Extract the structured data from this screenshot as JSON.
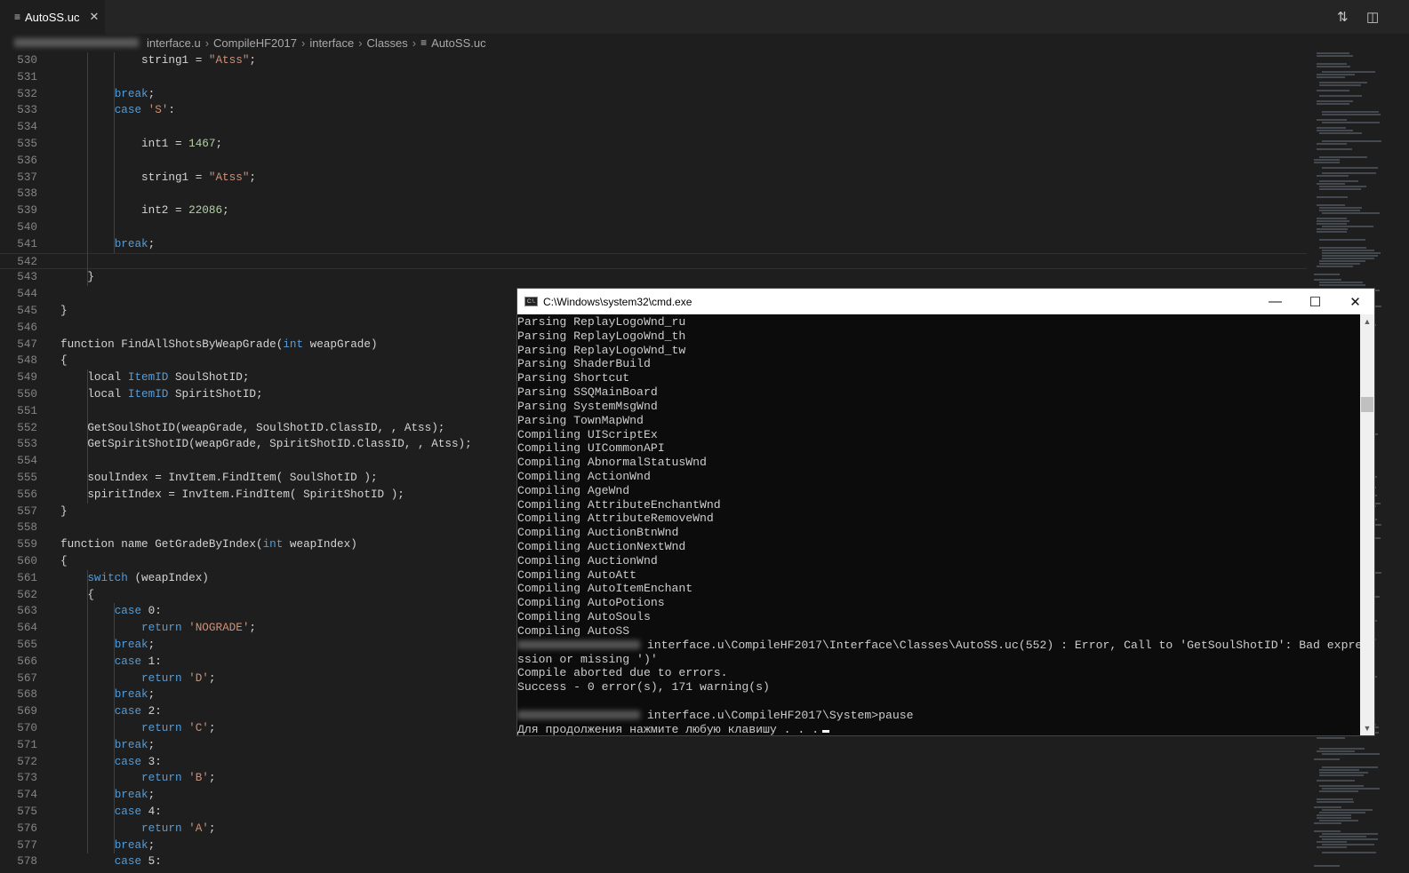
{
  "tab": {
    "icon": "file-lines-icon",
    "label": "AutoSS.uc",
    "close": "✕"
  },
  "toolbar_icons": [
    "compare-changes-icon",
    "split-editor-icon"
  ],
  "breadcrumb": [
    "interface.u",
    "CompileHF2017",
    "interface",
    "Classes",
    "AutoSS.uc"
  ],
  "colors": {
    "keyword": "#569cd6",
    "string": "#ce9178",
    "number": "#b5cea8",
    "text": "#d4d4d4",
    "background": "#1e1e1e"
  },
  "editor": {
    "current_line": 542,
    "lines": [
      {
        "n": 530,
        "tokens": [
          [
            "            string1 = ",
            "p"
          ],
          [
            "\"Atss\"",
            "s"
          ],
          [
            ";",
            "p"
          ]
        ]
      },
      {
        "n": 531,
        "tokens": []
      },
      {
        "n": 532,
        "tokens": [
          [
            "        ",
            "p"
          ],
          [
            "break",
            "k"
          ],
          [
            ";",
            "p"
          ]
        ]
      },
      {
        "n": 533,
        "tokens": [
          [
            "        ",
            "p"
          ],
          [
            "case",
            "k"
          ],
          [
            " ",
            "p"
          ],
          [
            "'S'",
            "s"
          ],
          [
            ":",
            "p"
          ]
        ]
      },
      {
        "n": 534,
        "tokens": []
      },
      {
        "n": 535,
        "tokens": [
          [
            "            int1 = ",
            "p"
          ],
          [
            "1467",
            "n"
          ],
          [
            ";",
            "p"
          ]
        ]
      },
      {
        "n": 536,
        "tokens": []
      },
      {
        "n": 537,
        "tokens": [
          [
            "            string1 = ",
            "p"
          ],
          [
            "\"Atss\"",
            "s"
          ],
          [
            ";",
            "p"
          ]
        ]
      },
      {
        "n": 538,
        "tokens": []
      },
      {
        "n": 539,
        "tokens": [
          [
            "            int2 = ",
            "p"
          ],
          [
            "22086",
            "n"
          ],
          [
            ";",
            "p"
          ]
        ]
      },
      {
        "n": 540,
        "tokens": []
      },
      {
        "n": 541,
        "tokens": [
          [
            "        ",
            "p"
          ],
          [
            "break",
            "k"
          ],
          [
            ";",
            "p"
          ]
        ]
      },
      {
        "n": 542,
        "tokens": []
      },
      {
        "n": 543,
        "tokens": [
          [
            "    }",
            "p"
          ]
        ]
      },
      {
        "n": 544,
        "tokens": []
      },
      {
        "n": 545,
        "tokens": [
          [
            "}",
            "p"
          ]
        ]
      },
      {
        "n": 546,
        "tokens": []
      },
      {
        "n": 547,
        "tokens": [
          [
            "function FindAllShotsByWeapGrade(",
            "p"
          ],
          [
            "int",
            "t"
          ],
          [
            " weapGrade)",
            "p"
          ]
        ]
      },
      {
        "n": 548,
        "tokens": [
          [
            "{",
            "p"
          ]
        ]
      },
      {
        "n": 549,
        "tokens": [
          [
            "    local ",
            "p"
          ],
          [
            "ItemID",
            "t"
          ],
          [
            " SoulShotID;",
            "p"
          ]
        ]
      },
      {
        "n": 550,
        "tokens": [
          [
            "    local ",
            "p"
          ],
          [
            "ItemID",
            "t"
          ],
          [
            " SpiritShotID;",
            "p"
          ]
        ]
      },
      {
        "n": 551,
        "tokens": []
      },
      {
        "n": 552,
        "tokens": [
          [
            "    GetSoulShotID(weapGrade, SoulShotID.ClassID, , Atss);",
            "p"
          ]
        ]
      },
      {
        "n": 553,
        "tokens": [
          [
            "    GetSpiritShotID(weapGrade, SpiritShotID.ClassID, , Atss);",
            "p"
          ]
        ]
      },
      {
        "n": 554,
        "tokens": []
      },
      {
        "n": 555,
        "tokens": [
          [
            "    soulIndex = InvItem.FindItem( SoulShotID );",
            "p"
          ]
        ]
      },
      {
        "n": 556,
        "tokens": [
          [
            "    spiritIndex = InvItem.FindItem( SpiritShotID );",
            "p"
          ]
        ]
      },
      {
        "n": 557,
        "tokens": [
          [
            "}",
            "p"
          ]
        ]
      },
      {
        "n": 558,
        "tokens": []
      },
      {
        "n": 559,
        "tokens": [
          [
            "function name GetGradeByIndex(",
            "p"
          ],
          [
            "int",
            "t"
          ],
          [
            " weapIndex)",
            "p"
          ]
        ]
      },
      {
        "n": 560,
        "tokens": [
          [
            "{",
            "p"
          ]
        ]
      },
      {
        "n": 561,
        "tokens": [
          [
            "    ",
            "p"
          ],
          [
            "switch",
            "k"
          ],
          [
            " (weapIndex)",
            "p"
          ]
        ]
      },
      {
        "n": 562,
        "tokens": [
          [
            "    {",
            "p"
          ]
        ]
      },
      {
        "n": 563,
        "tokens": [
          [
            "        ",
            "p"
          ],
          [
            "case",
            "k"
          ],
          [
            " 0:",
            "p"
          ]
        ]
      },
      {
        "n": 564,
        "tokens": [
          [
            "            ",
            "p"
          ],
          [
            "return",
            "k"
          ],
          [
            " ",
            "p"
          ],
          [
            "'NOGRADE'",
            "s"
          ],
          [
            ";",
            "p"
          ]
        ]
      },
      {
        "n": 565,
        "tokens": [
          [
            "        ",
            "p"
          ],
          [
            "break",
            "k"
          ],
          [
            ";",
            "p"
          ]
        ]
      },
      {
        "n": 566,
        "tokens": [
          [
            "        ",
            "p"
          ],
          [
            "case",
            "k"
          ],
          [
            " 1:",
            "p"
          ]
        ]
      },
      {
        "n": 567,
        "tokens": [
          [
            "            ",
            "p"
          ],
          [
            "return",
            "k"
          ],
          [
            " ",
            "p"
          ],
          [
            "'D'",
            "s"
          ],
          [
            ";",
            "p"
          ]
        ]
      },
      {
        "n": 568,
        "tokens": [
          [
            "        ",
            "p"
          ],
          [
            "break",
            "k"
          ],
          [
            ";",
            "p"
          ]
        ]
      },
      {
        "n": 569,
        "tokens": [
          [
            "        ",
            "p"
          ],
          [
            "case",
            "k"
          ],
          [
            " 2:",
            "p"
          ]
        ]
      },
      {
        "n": 570,
        "tokens": [
          [
            "            ",
            "p"
          ],
          [
            "return",
            "k"
          ],
          [
            " ",
            "p"
          ],
          [
            "'C'",
            "s"
          ],
          [
            ";",
            "p"
          ]
        ]
      },
      {
        "n": 571,
        "tokens": [
          [
            "        ",
            "p"
          ],
          [
            "break",
            "k"
          ],
          [
            ";",
            "p"
          ]
        ]
      },
      {
        "n": 572,
        "tokens": [
          [
            "        ",
            "p"
          ],
          [
            "case",
            "k"
          ],
          [
            " 3:",
            "p"
          ]
        ]
      },
      {
        "n": 573,
        "tokens": [
          [
            "            ",
            "p"
          ],
          [
            "return",
            "k"
          ],
          [
            " ",
            "p"
          ],
          [
            "'B'",
            "s"
          ],
          [
            ";",
            "p"
          ]
        ]
      },
      {
        "n": 574,
        "tokens": [
          [
            "        ",
            "p"
          ],
          [
            "break",
            "k"
          ],
          [
            ";",
            "p"
          ]
        ]
      },
      {
        "n": 575,
        "tokens": [
          [
            "        ",
            "p"
          ],
          [
            "case",
            "k"
          ],
          [
            " 4:",
            "p"
          ]
        ]
      },
      {
        "n": 576,
        "tokens": [
          [
            "            ",
            "p"
          ],
          [
            "return",
            "k"
          ],
          [
            " ",
            "p"
          ],
          [
            "'A'",
            "s"
          ],
          [
            ";",
            "p"
          ]
        ]
      },
      {
        "n": 577,
        "tokens": [
          [
            "        ",
            "p"
          ],
          [
            "break",
            "k"
          ],
          [
            ";",
            "p"
          ]
        ]
      },
      {
        "n": 578,
        "tokens": [
          [
            "        ",
            "p"
          ],
          [
            "case",
            "k"
          ],
          [
            " 5:",
            "p"
          ]
        ]
      }
    ]
  },
  "cmd": {
    "title": "C:\\Windows\\system32\\cmd.exe",
    "icon_label": "C:\\.",
    "buttons": {
      "minimize": "—",
      "maximize": "☐",
      "close": "✕"
    },
    "scroll_up": "▲",
    "scroll_down": "▼",
    "lines": [
      {
        "text": "Parsing ReplayLogoWnd_ru"
      },
      {
        "text": "Parsing ReplayLogoWnd_th"
      },
      {
        "text": "Parsing ReplayLogoWnd_tw"
      },
      {
        "text": "Parsing ShaderBuild"
      },
      {
        "text": "Parsing Shortcut"
      },
      {
        "text": "Parsing SSQMainBoard"
      },
      {
        "text": "Parsing SystemMsgWnd"
      },
      {
        "text": "Parsing TownMapWnd"
      },
      {
        "text": "Compiling UIScriptEx"
      },
      {
        "text": "Compiling UICommonAPI"
      },
      {
        "text": "Compiling AbnormalStatusWnd"
      },
      {
        "text": "Compiling ActionWnd"
      },
      {
        "text": "Compiling AgeWnd"
      },
      {
        "text": "Compiling AttributeEnchantWnd"
      },
      {
        "text": "Compiling AttributeRemoveWnd"
      },
      {
        "text": "Compiling AuctionBtnWnd"
      },
      {
        "text": "Compiling AuctionNextWnd"
      },
      {
        "text": "Compiling AuctionWnd"
      },
      {
        "text": "Compiling AutoAtt"
      },
      {
        "text": "Compiling AutoItemEnchant"
      },
      {
        "text": "Compiling AutoPotions"
      },
      {
        "text": "Compiling AutoSouls"
      },
      {
        "text": "Compiling AutoSS"
      },
      {
        "text": "interface.u\\CompileHF2017\\Interface\\Classes\\AutoSS.uc(552) : Error, Call to 'GetSoulShotID': Bad expre",
        "blurred_prefix": true
      },
      {
        "text": "ssion or missing ')'"
      },
      {
        "text": "Compile aborted due to errors."
      },
      {
        "text": "Success - 0 error(s), 171 warning(s)"
      },
      {
        "text": ""
      },
      {
        "text": "interface.u\\CompileHF2017\\System>pause",
        "blurred_prefix": true
      },
      {
        "text": "Для продолжения нажмите любую клавишу . . .",
        "cursor": true
      }
    ]
  }
}
